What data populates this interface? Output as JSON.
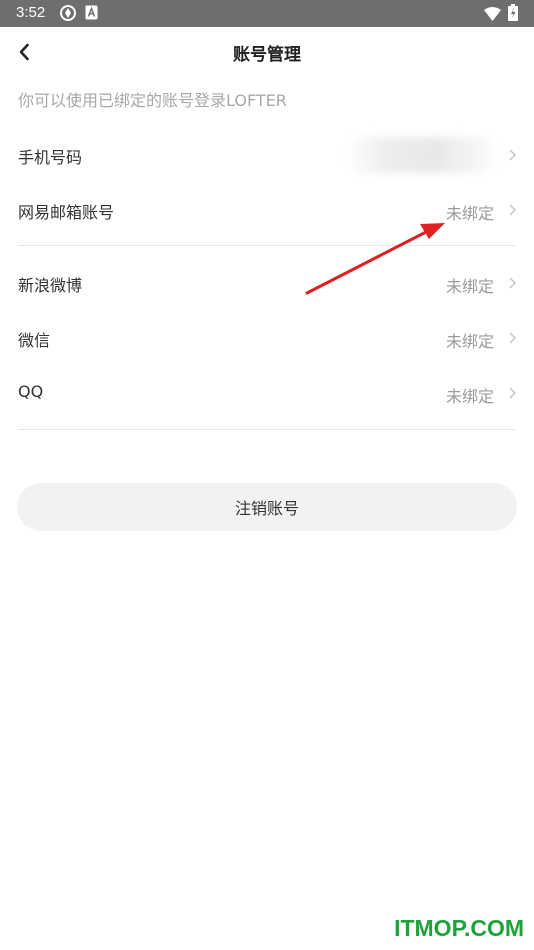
{
  "status_bar": {
    "time": "3:52",
    "icons": [
      "sync-icon",
      "font-a-icon",
      "wifi-icon",
      "battery-icon"
    ]
  },
  "header": {
    "title": "账号管理",
    "back_icon": "chevron-left-icon"
  },
  "hint": "你可以使用已绑定的账号登录LOFTER",
  "accounts": {
    "phone": {
      "label": "手机号码",
      "status": ""
    },
    "netease_email": {
      "label": "网易邮箱账号",
      "status": "未绑定"
    },
    "weibo": {
      "label": "新浪微博",
      "status": "未绑定"
    },
    "wechat": {
      "label": "微信",
      "status": "未绑定"
    },
    "qq": {
      "label": "QQ",
      "status": "未绑定"
    }
  },
  "cancel_button": {
    "label": "注销账号"
  },
  "annotation_color": "#e02020",
  "watermark": "ITMOP.COM"
}
